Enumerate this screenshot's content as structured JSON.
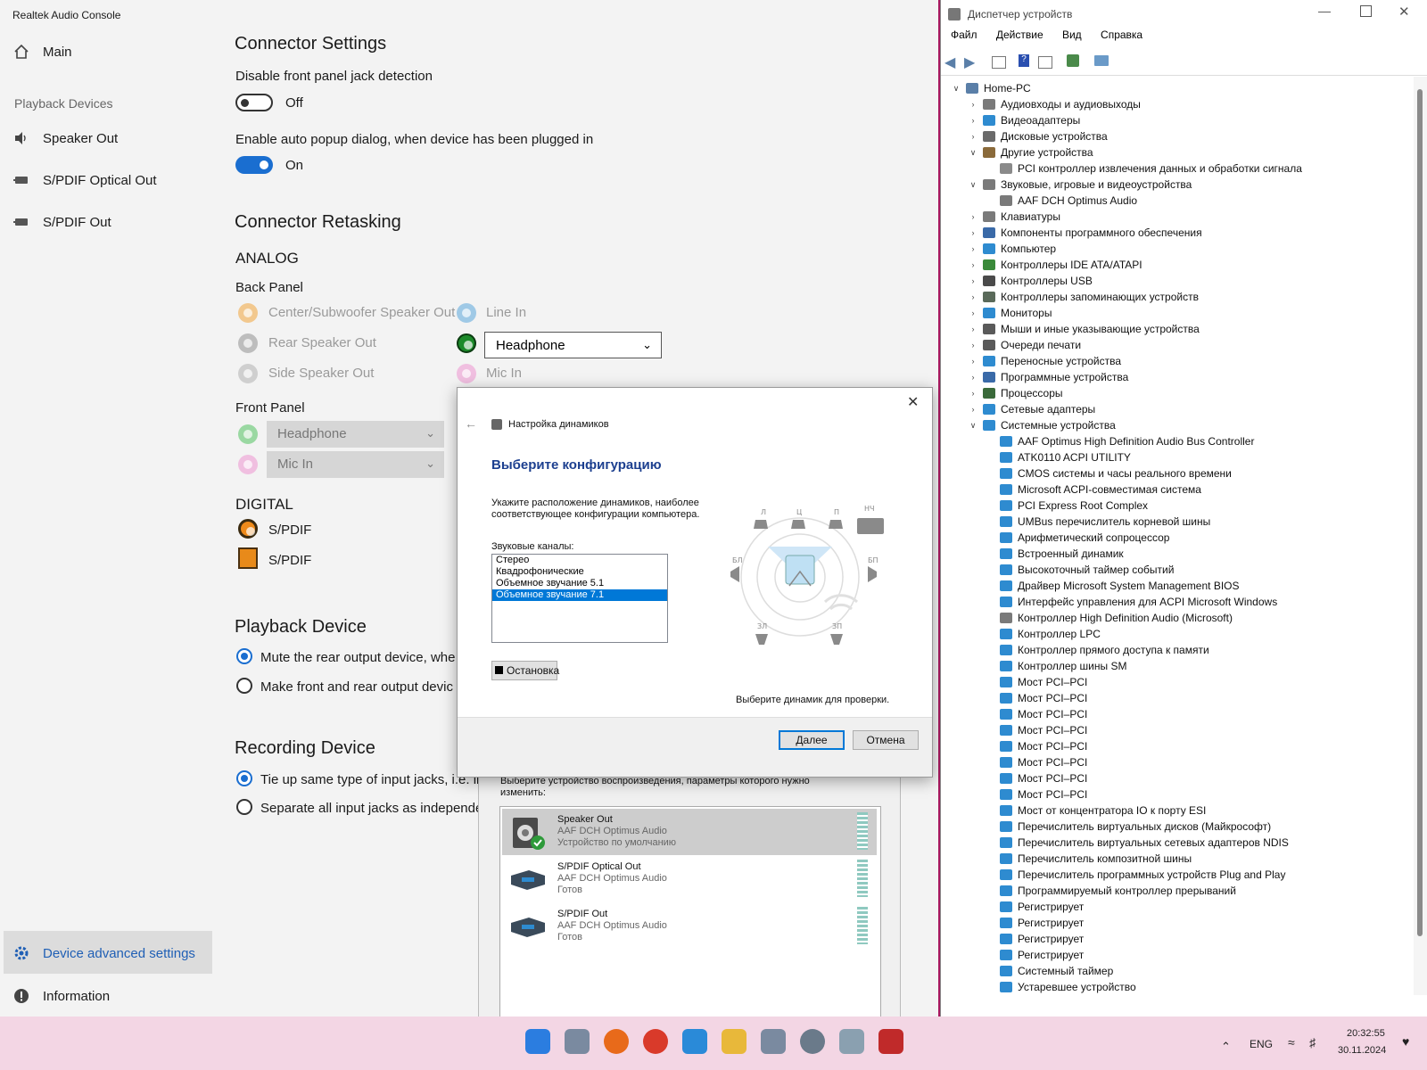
{
  "realtek": {
    "title": "Realtek Audio Console",
    "nav": {
      "main": "Main",
      "playback_heading": "Playback Devices",
      "speaker_out": "Speaker Out",
      "spdif_optical": "S/PDIF Optical Out",
      "spdif_out": "S/PDIF Out",
      "advanced": "Device advanced settings",
      "information": "Information"
    },
    "connector_settings": {
      "heading": "Connector Settings",
      "disable_front_label": "Disable front panel jack detection",
      "disable_front_state": "Off",
      "auto_popup_label": "Enable auto popup dialog, when device has been plugged in",
      "auto_popup_state": "On"
    },
    "retasking": {
      "heading": "Connector Retasking",
      "analog": "ANALOG",
      "back_panel": "Back Panel",
      "center_sub": "Center/Subwoofer Speaker Out",
      "rear": "Rear Speaker Out",
      "side": "Side Speaker Out",
      "line_in": "Line In",
      "headphone_select": "Headphone",
      "mic_in": "Mic In",
      "front_panel": "Front Panel",
      "front_headphone": "Headphone",
      "front_mic": "Mic In",
      "digital": "DIGITAL",
      "spdif1": "S/PDIF",
      "spdif2": "S/PDIF"
    },
    "playback_device": {
      "heading": "Playback Device",
      "opt1": "Mute the rear output device, whe",
      "opt2": "Make front and rear output devic"
    },
    "recording_device": {
      "heading": "Recording Device",
      "opt1": "Tie up same type of input jacks, i.e. lir",
      "opt2": "Separate all input jacks as independen"
    }
  },
  "sound_dialog": {
    "instruction": "Выберите устройство воспроизведения, параметры которого нужно изменить:",
    "devices": [
      {
        "name": "Speaker Out",
        "driver": "AAF DCH Optimus Audio",
        "status": "Устройство по умолчанию"
      },
      {
        "name": "S/PDIF Optical Out",
        "driver": "AAF DCH Optimus Audio",
        "status": "Готов"
      },
      {
        "name": "S/PDIF Out",
        "driver": "AAF DCH Optimus Audio",
        "status": "Готов"
      }
    ]
  },
  "speaker_setup": {
    "title": "Настройка динамиков",
    "heading": "Выберите конфигурацию",
    "desc1": "Укажите расположение динамиков, наиболее",
    "desc2": "соответствующее конфигурации компьютера.",
    "channels_label": "Звуковые каналы:",
    "channels": [
      "Стерео",
      "Квадрофонические",
      "Объемное звучание 5.1",
      "Объемное звучание 7.1"
    ],
    "selected_channel": "Объемное звучание 7.1",
    "stop_button": "Остановка",
    "test_hint": "Выберите динамик для проверки.",
    "next_button": "Далее",
    "cancel_button": "Отмена",
    "speaker_labels": [
      "Л",
      "Ц",
      "П",
      "НЧ",
      "БЛ",
      "БП",
      "ЗЛ",
      "ЗП"
    ]
  },
  "device_manager": {
    "title": "Диспетчер устройств",
    "menu": [
      "Файл",
      "Действие",
      "Вид",
      "Справка"
    ],
    "tree": [
      {
        "label": "Home-PC",
        "level": 0,
        "exp": "v",
        "color": "#5a7fa8"
      },
      {
        "label": "Аудиовходы и аудиовыходы",
        "level": 1,
        "exp": ">",
        "color": "#7a7a7a"
      },
      {
        "label": "Видеоадаптеры",
        "level": 1,
        "exp": ">",
        "color": "#2e8bd0"
      },
      {
        "label": "Дисковые устройства",
        "level": 1,
        "exp": ">",
        "color": "#6a6a6a"
      },
      {
        "label": "Другие устройства",
        "level": 1,
        "exp": "v",
        "color": "#8a6a3a"
      },
      {
        "label": "PCI контроллер извлечения данных и обработки сигнала",
        "level": 2,
        "exp": "",
        "color": "#8a8a8a"
      },
      {
        "label": "Звуковые, игровые и видеоустройства",
        "level": 1,
        "exp": "v",
        "color": "#7a7a7a"
      },
      {
        "label": "AAF DCH Optimus Audio",
        "level": 2,
        "exp": "",
        "color": "#7a7a7a"
      },
      {
        "label": "Клавиатуры",
        "level": 1,
        "exp": ">",
        "color": "#7a7a7a"
      },
      {
        "label": "Компоненты программного обеспечения",
        "level": 1,
        "exp": ">",
        "color": "#3a6aa8"
      },
      {
        "label": "Компьютер",
        "level": 1,
        "exp": ">",
        "color": "#2e8bd0"
      },
      {
        "label": "Контроллеры IDE ATA/ATAPI",
        "level": 1,
        "exp": ">",
        "color": "#3a8a3a"
      },
      {
        "label": "Контроллеры USB",
        "level": 1,
        "exp": ">",
        "color": "#4a4a4a"
      },
      {
        "label": "Контроллеры запоминающих устройств",
        "level": 1,
        "exp": ">",
        "color": "#5a6a5a"
      },
      {
        "label": "Мониторы",
        "level": 1,
        "exp": ">",
        "color": "#2e8bd0"
      },
      {
        "label": "Мыши и иные указывающие устройства",
        "level": 1,
        "exp": ">",
        "color": "#5a5a5a"
      },
      {
        "label": "Очереди печати",
        "level": 1,
        "exp": ">",
        "color": "#5a5a5a"
      },
      {
        "label": "Переносные устройства",
        "level": 1,
        "exp": ">",
        "color": "#2e8bd0"
      },
      {
        "label": "Программные устройства",
        "level": 1,
        "exp": ">",
        "color": "#3a6aa8"
      },
      {
        "label": "Процессоры",
        "level": 1,
        "exp": ">",
        "color": "#3a6a3a"
      },
      {
        "label": "Сетевые адаптеры",
        "level": 1,
        "exp": ">",
        "color": "#2e8bd0"
      },
      {
        "label": "Системные устройства",
        "level": 1,
        "exp": "v",
        "color": "#2e8bd0"
      },
      {
        "label": "AAF Optimus High Definition Audio Bus Controller",
        "level": 2,
        "exp": "",
        "color": "#2e8bd0"
      },
      {
        "label": "ATK0110 ACPI UTILITY",
        "level": 2,
        "exp": "",
        "color": "#2e8bd0"
      },
      {
        "label": "CMOS системы и часы реального времени",
        "level": 2,
        "exp": "",
        "color": "#2e8bd0"
      },
      {
        "label": "Microsoft ACPI-совместимая система",
        "level": 2,
        "exp": "",
        "color": "#2e8bd0"
      },
      {
        "label": "PCI Express Root Complex",
        "level": 2,
        "exp": "",
        "color": "#2e8bd0"
      },
      {
        "label": "UMBus перечислитель корневой шины",
        "level": 2,
        "exp": "",
        "color": "#2e8bd0"
      },
      {
        "label": "Арифметический сопроцессор",
        "level": 2,
        "exp": "",
        "color": "#2e8bd0"
      },
      {
        "label": "Встроенный динамик",
        "level": 2,
        "exp": "",
        "color": "#2e8bd0"
      },
      {
        "label": "Высокоточный таймер событий",
        "level": 2,
        "exp": "",
        "color": "#2e8bd0"
      },
      {
        "label": "Драйвер Microsoft System Management BIOS",
        "level": 2,
        "exp": "",
        "color": "#2e8bd0"
      },
      {
        "label": "Интерфейс управления для ACPI Microsoft Windows",
        "level": 2,
        "exp": "",
        "color": "#2e8bd0"
      },
      {
        "label": "Контроллер High Definition Audio (Microsoft)",
        "level": 2,
        "exp": "",
        "color": "#7a7a7a"
      },
      {
        "label": "Контроллер LPC",
        "level": 2,
        "exp": "",
        "color": "#2e8bd0"
      },
      {
        "label": "Контроллер прямого доступа к памяти",
        "level": 2,
        "exp": "",
        "color": "#2e8bd0"
      },
      {
        "label": "Контроллер шины SM",
        "level": 2,
        "exp": "",
        "color": "#2e8bd0"
      },
      {
        "label": "Мост PCI–PCI",
        "level": 2,
        "exp": "",
        "color": "#2e8bd0"
      },
      {
        "label": "Мост PCI–PCI",
        "level": 2,
        "exp": "",
        "color": "#2e8bd0"
      },
      {
        "label": "Мост PCI–PCI",
        "level": 2,
        "exp": "",
        "color": "#2e8bd0"
      },
      {
        "label": "Мост PCI–PCI",
        "level": 2,
        "exp": "",
        "color": "#2e8bd0"
      },
      {
        "label": "Мост PCI–PCI",
        "level": 2,
        "exp": "",
        "color": "#2e8bd0"
      },
      {
        "label": "Мост PCI–PCI",
        "level": 2,
        "exp": "",
        "color": "#2e8bd0"
      },
      {
        "label": "Мост PCI–PCI",
        "level": 2,
        "exp": "",
        "color": "#2e8bd0"
      },
      {
        "label": "Мост PCI–PCI",
        "level": 2,
        "exp": "",
        "color": "#2e8bd0"
      },
      {
        "label": "Мост от концентратора IO к порту ESI",
        "level": 2,
        "exp": "",
        "color": "#2e8bd0"
      },
      {
        "label": "Перечислитель виртуальных дисков (Майкрософт)",
        "level": 2,
        "exp": "",
        "color": "#2e8bd0"
      },
      {
        "label": "Перечислитель виртуальных сетевых адаптеров NDIS",
        "level": 2,
        "exp": "",
        "color": "#2e8bd0"
      },
      {
        "label": "Перечислитель композитной шины",
        "level": 2,
        "exp": "",
        "color": "#2e8bd0"
      },
      {
        "label": "Перечислитель программных устройств Plug and Play",
        "level": 2,
        "exp": "",
        "color": "#2e8bd0"
      },
      {
        "label": "Программируемый контроллер прерываний",
        "level": 2,
        "exp": "",
        "color": "#2e8bd0"
      },
      {
        "label": "Регистрирует",
        "level": 2,
        "exp": "",
        "color": "#2e8bd0"
      },
      {
        "label": "Регистрирует",
        "level": 2,
        "exp": "",
        "color": "#2e8bd0"
      },
      {
        "label": "Регистрирует",
        "level": 2,
        "exp": "",
        "color": "#2e8bd0"
      },
      {
        "label": "Регистрирует",
        "level": 2,
        "exp": "",
        "color": "#2e8bd0"
      },
      {
        "label": "Системный таймер",
        "level": 2,
        "exp": "",
        "color": "#2e8bd0"
      },
      {
        "label": "Устаревшее устройство",
        "level": 2,
        "exp": "",
        "color": "#2e8bd0"
      }
    ]
  },
  "taskbar": {
    "lang": "ENG",
    "time": "20:32:55",
    "date": "30.11.2024"
  }
}
